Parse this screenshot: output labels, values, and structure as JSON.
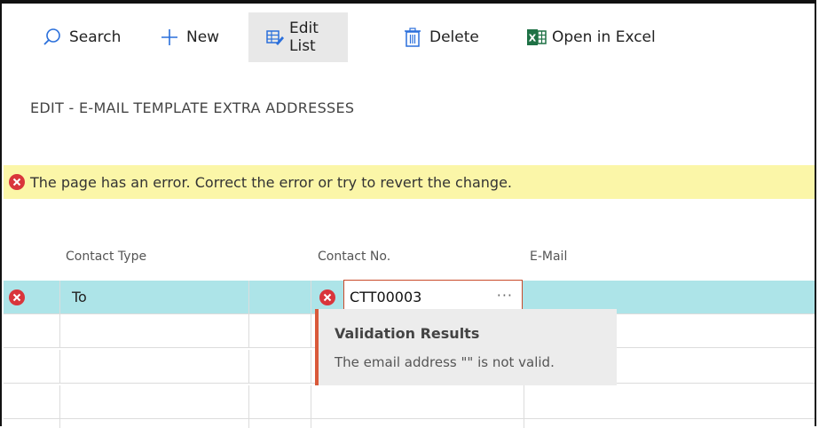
{
  "toolbar": {
    "search_label": "Search",
    "new_label": "New",
    "edit_list_label": "Edit List",
    "delete_label": "Delete",
    "excel_label": "Open in Excel"
  },
  "page": {
    "title": "EDIT - E-MAIL TEMPLATE EXTRA ADDRESSES"
  },
  "error_bar": {
    "message": "The page has an error. Correct the error or try to revert the change."
  },
  "table": {
    "columns": [
      "Contact Type",
      "Contact No.",
      "E-Mail"
    ],
    "rows": [
      {
        "contact_type": "To",
        "contact_no": "CTT00003",
        "email": ""
      }
    ]
  },
  "validation": {
    "title": "Validation Results",
    "message": "The email address \"\" is not valid."
  },
  "colors": {
    "selected_row": "#ade4e8",
    "error_red": "#d9353b",
    "error_bar_bg": "#fbf6a8",
    "excel_green": "#1e7145"
  }
}
